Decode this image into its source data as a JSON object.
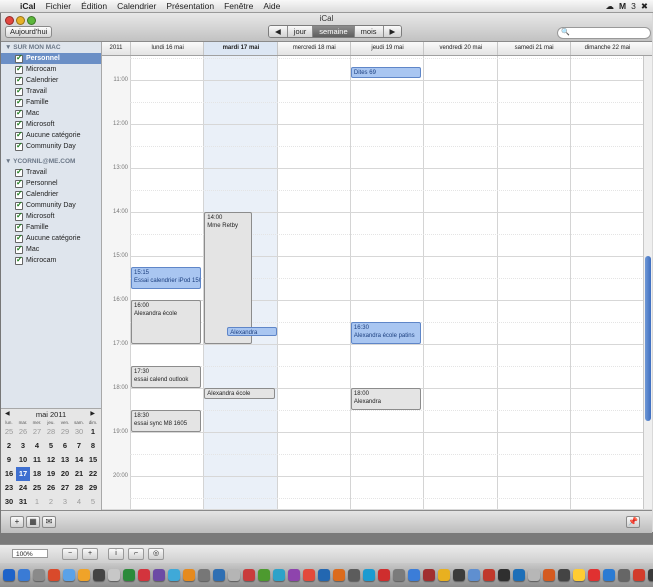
{
  "menubar": {
    "app": "iCal",
    "items": [
      "Fichier",
      "Édition",
      "Calendrier",
      "Présentation",
      "Fenêtre",
      "Aide"
    ],
    "status_text": "3"
  },
  "window": {
    "title": "iCal",
    "today_button": "Aujourd'hui",
    "views": [
      "jour",
      "semaine",
      "mois"
    ],
    "selected_view": "semaine"
  },
  "sidebar": {
    "groups": [
      {
        "title": "SUR MON MAC",
        "items": [
          "Personnel",
          "Microcam",
          "Calendrier",
          "Travail",
          "Famille",
          "Mac",
          "Microsoft",
          "Aucune catégorie",
          "Community Day"
        ],
        "selected": "Personnel"
      },
      {
        "title": "YCORNIL@ME.COM",
        "items": [
          "Travail",
          "Personnel",
          "Calendrier",
          "Community Day",
          "Microsoft",
          "Famille",
          "Aucune catégorie",
          "Mac",
          "Microcam"
        ]
      }
    ]
  },
  "mini_calendar": {
    "title": "mai 2011",
    "weekdays": [
      "lun.",
      "mar.",
      "mer.",
      "jeu.",
      "ven.",
      "sam.",
      "dim."
    ],
    "weeks": [
      [
        "25",
        "26",
        "27",
        "28",
        "29",
        "30",
        "1"
      ],
      [
        "2",
        "3",
        "4",
        "5",
        "6",
        "7",
        "8"
      ],
      [
        "9",
        "10",
        "11",
        "12",
        "13",
        "14",
        "15"
      ],
      [
        "16",
        "17",
        "18",
        "19",
        "20",
        "21",
        "22"
      ],
      [
        "23",
        "24",
        "25",
        "26",
        "27",
        "28",
        "29"
      ],
      [
        "30",
        "31",
        "1",
        "2",
        "3",
        "4",
        "5"
      ]
    ],
    "today": "17"
  },
  "week_header": {
    "year": "2011",
    "days": [
      "lundi 16 mai",
      "mardi 17 mai",
      "mercredi 18 mai",
      "jeudi 19 mai",
      "vendredi 20 mai",
      "samedi 21 mai",
      "dimanche 22 mai"
    ],
    "current_day": "mardi 17 mai"
  },
  "time_labels": [
    "11:00",
    "12:00",
    "13:00",
    "14:00",
    "15:00",
    "16:00",
    "17:00",
    "18:00",
    "19:00",
    "20:00"
  ],
  "events": [
    {
      "day": 3,
      "start": 10.7,
      "end": 10.95,
      "time": "",
      "title": "Dites 69",
      "color": "blue"
    },
    {
      "day": 1,
      "start": 14.0,
      "end": 17.0,
      "time": "14:00",
      "title": "Mme Retby",
      "color": "gray"
    },
    {
      "day": 0,
      "start": 15.25,
      "end": 15.75,
      "time": "15:15",
      "title": "Essai calendrier iPod 1505/1",
      "color": "blue"
    },
    {
      "day": 0,
      "start": 16.0,
      "end": 17.0,
      "time": "16:00",
      "title": "Alexandra école",
      "color": "gray"
    },
    {
      "day": 1,
      "start": 16.6,
      "end": 16.82,
      "time": "",
      "title": "Alexandra",
      "color": "blue",
      "half": true
    },
    {
      "day": 3,
      "start": 16.5,
      "end": 17.0,
      "time": "16:30",
      "title": "Alexandra école patins",
      "color": "blue"
    },
    {
      "day": 0,
      "start": 17.5,
      "end": 18.0,
      "time": "17:30",
      "title": "essai calend outlook",
      "color": "gray"
    },
    {
      "day": 1,
      "start": 18.0,
      "end": 18.25,
      "time": "",
      "title": "Alexandra école",
      "color": "gray"
    },
    {
      "day": 3,
      "start": 18.0,
      "end": 18.5,
      "time": "18:00",
      "title": "Alexandra",
      "color": "gray"
    },
    {
      "day": 0,
      "start": 18.5,
      "end": 19.0,
      "time": "18:30",
      "title": "essai sync M8 1605",
      "color": "gray"
    }
  ],
  "status_bar": {
    "zoom": "100%"
  },
  "colors": {
    "accent": "#3e6fd0",
    "event_blue": "#a9c6f1",
    "event_gray": "#e4e4e4",
    "sidebar_bg": "#dfe5ed"
  }
}
